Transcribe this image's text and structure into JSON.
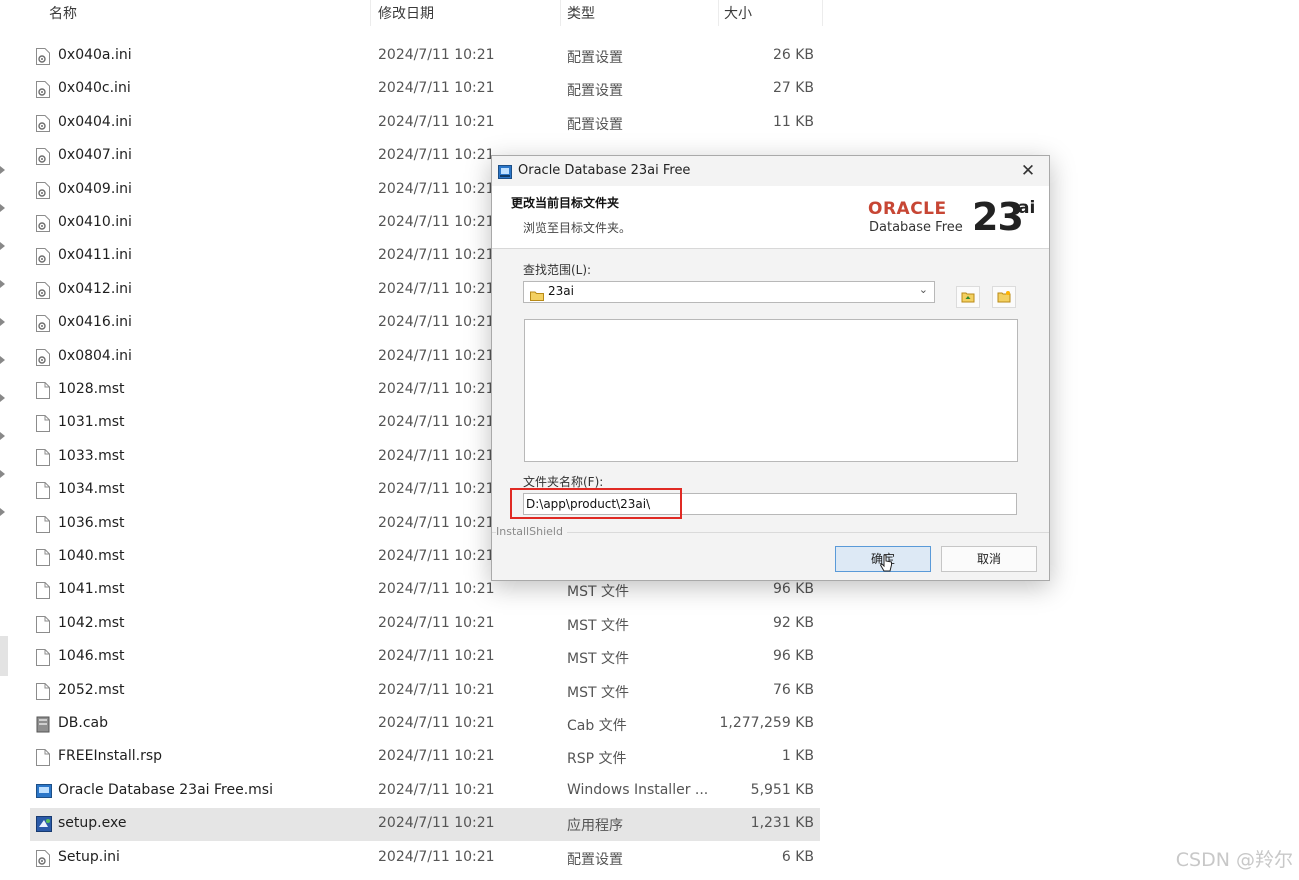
{
  "header": {
    "col_name": "名称",
    "col_date": "修改日期",
    "col_type": "类型",
    "col_size": "大小"
  },
  "files": [
    {
      "name": "0x040a.ini",
      "date": "2024/7/11 10:21",
      "type": "配置设置",
      "size": "26 KB",
      "icon": "ini-file-icon"
    },
    {
      "name": "0x040c.ini",
      "date": "2024/7/11 10:21",
      "type": "配置设置",
      "size": "27 KB",
      "icon": "ini-file-icon"
    },
    {
      "name": "0x0404.ini",
      "date": "2024/7/11 10:21",
      "type": "配置设置",
      "size": "11 KB",
      "icon": "ini-file-icon"
    },
    {
      "name": "0x0407.ini",
      "date": "2024/7/11 10:21",
      "type": "",
      "size": "",
      "icon": "ini-file-icon"
    },
    {
      "name": "0x0409.ini",
      "date": "2024/7/11 10:21",
      "type": "",
      "size": "",
      "icon": "ini-file-icon"
    },
    {
      "name": "0x0410.ini",
      "date": "2024/7/11 10:21",
      "type": "",
      "size": "",
      "icon": "ini-file-icon"
    },
    {
      "name": "0x0411.ini",
      "date": "2024/7/11 10:21",
      "type": "",
      "size": "",
      "icon": "ini-file-icon"
    },
    {
      "name": "0x0412.ini",
      "date": "2024/7/11 10:21",
      "type": "",
      "size": "",
      "icon": "ini-file-icon"
    },
    {
      "name": "0x0416.ini",
      "date": "2024/7/11 10:21",
      "type": "",
      "size": "",
      "icon": "ini-file-icon"
    },
    {
      "name": "0x0804.ini",
      "date": "2024/7/11 10:21",
      "type": "",
      "size": "",
      "icon": "ini-file-icon"
    },
    {
      "name": "1028.mst",
      "date": "2024/7/11 10:21",
      "type": "",
      "size": "",
      "icon": "blank-file-icon"
    },
    {
      "name": "1031.mst",
      "date": "2024/7/11 10:21",
      "type": "",
      "size": "",
      "icon": "blank-file-icon"
    },
    {
      "name": "1033.mst",
      "date": "2024/7/11 10:21",
      "type": "",
      "size": "",
      "icon": "blank-file-icon"
    },
    {
      "name": "1034.mst",
      "date": "2024/7/11 10:21",
      "type": "",
      "size": "",
      "icon": "blank-file-icon"
    },
    {
      "name": "1036.mst",
      "date": "2024/7/11 10:21",
      "type": "",
      "size": "",
      "icon": "blank-file-icon"
    },
    {
      "name": "1040.mst",
      "date": "2024/7/11 10:21",
      "type": "",
      "size": "",
      "icon": "blank-file-icon"
    },
    {
      "name": "1041.mst",
      "date": "2024/7/11 10:21",
      "type": "MST 文件",
      "size": "96 KB",
      "icon": "blank-file-icon"
    },
    {
      "name": "1042.mst",
      "date": "2024/7/11 10:21",
      "type": "MST 文件",
      "size": "92 KB",
      "icon": "blank-file-icon"
    },
    {
      "name": "1046.mst",
      "date": "2024/7/11 10:21",
      "type": "MST 文件",
      "size": "96 KB",
      "icon": "blank-file-icon"
    },
    {
      "name": "2052.mst",
      "date": "2024/7/11 10:21",
      "type": "MST 文件",
      "size": "76 KB",
      "icon": "blank-file-icon"
    },
    {
      "name": "DB.cab",
      "date": "2024/7/11 10:21",
      "type": "Cab 文件",
      "size": "1,277,259 KB",
      "icon": "cab-file-icon"
    },
    {
      "name": "FREEInstall.rsp",
      "date": "2024/7/11 10:21",
      "type": "RSP 文件",
      "size": "1 KB",
      "icon": "blank-file-icon"
    },
    {
      "name": "Oracle Database 23ai Free.msi",
      "date": "2024/7/11 10:21",
      "type": "Windows Installer ...",
      "size": "5,951 KB",
      "icon": "msi-file-icon"
    },
    {
      "name": "setup.exe",
      "date": "2024/7/11 10:21",
      "type": "应用程序",
      "size": "1,231 KB",
      "icon": "exe-file-icon",
      "selected": true
    },
    {
      "name": "Setup.ini",
      "date": "2024/7/11 10:21",
      "type": "配置设置",
      "size": "6 KB",
      "icon": "ini-file-icon"
    }
  ],
  "dialog": {
    "title": "Oracle Database 23ai Free",
    "close_glyph": "✕",
    "heading": "更改当前目标文件夹",
    "subheading": "浏览至目标文件夹。",
    "logo": {
      "oracle": "ORACLE",
      "product": "Database Free",
      "version": "23",
      "suffix": "ai"
    },
    "look_in_label": "查找范围(L):",
    "look_in_value": "23ai",
    "folder_name_label": "文件夹名称(F):",
    "folder_path": "D:\\app\\product\\23ai\\",
    "brand": "InstallShield",
    "ok_label": "确定",
    "cancel_label": "取消",
    "highlight_color": "#e02a24"
  },
  "watermark": "CSDN @羚尔"
}
